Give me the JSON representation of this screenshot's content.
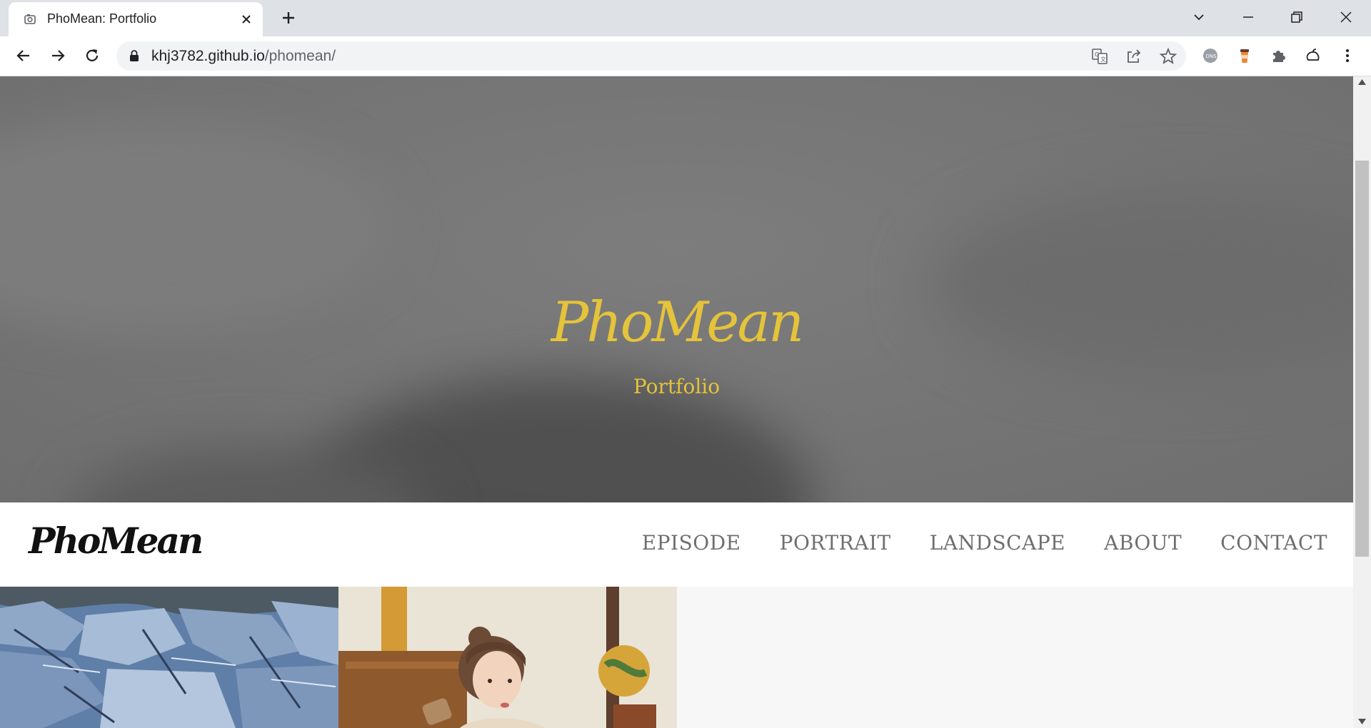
{
  "browser": {
    "tab_title": "PhoMean: Portfolio",
    "url_host": "khj3782.github.io",
    "url_path": "/phomean/",
    "icons": [
      "camera-favicon",
      "close-icon",
      "plus-icon",
      "chevron-down-icon",
      "minimize-icon",
      "restore-icon",
      "close-window-icon",
      "back-icon",
      "forward-icon",
      "reload-icon",
      "lock-icon",
      "translate-icon",
      "share-icon",
      "star-icon",
      "extension-icon",
      "puzzle-icon",
      "profile-icon",
      "menu-icon"
    ]
  },
  "hero": {
    "logo": "PhoMean",
    "subtitle": "Portfolio",
    "accent_color": "#e5c33a"
  },
  "nav": {
    "logo": "PhoMean",
    "items": [
      "EPISODE",
      "PORTRAIT",
      "LANDSCAPE",
      "ABOUT",
      "CONTACT"
    ]
  },
  "gallery": {
    "items": [
      {
        "name": "landscape-rocks-photo"
      },
      {
        "name": "portrait-girl-photo"
      }
    ]
  }
}
